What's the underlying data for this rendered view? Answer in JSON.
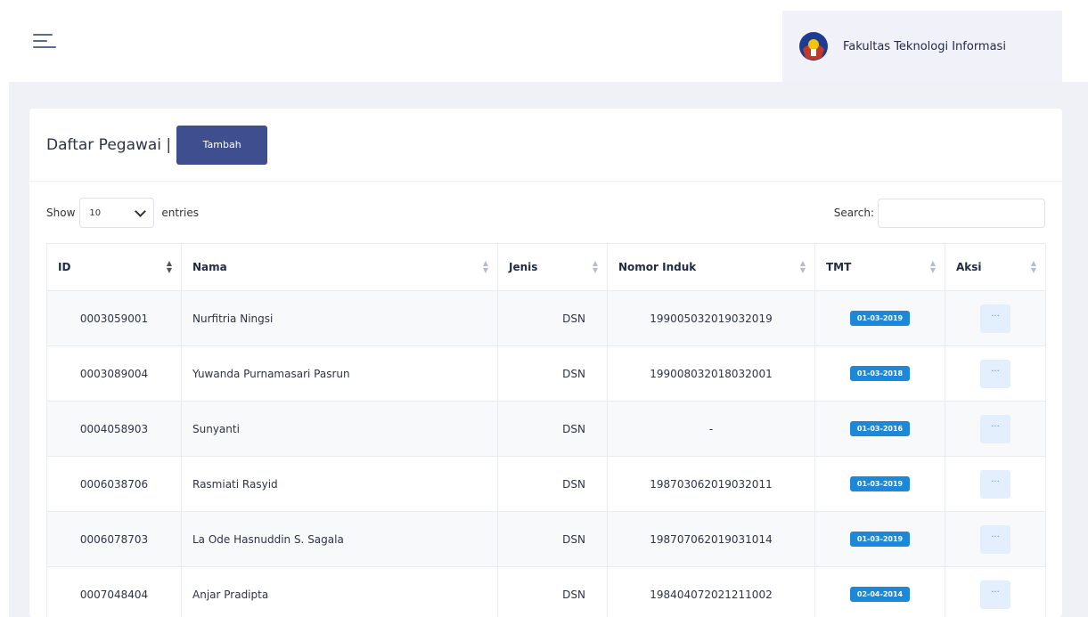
{
  "brand": {
    "name": "Fakultas Teknologi Informasi",
    "logo_icon": "university-logo-icon"
  },
  "card": {
    "title": "Daftar Pegawai |",
    "add_label": "Tambah"
  },
  "controls": {
    "show_label": "Show",
    "entries_value": "10",
    "entries_label": "entries",
    "search_label": "Search:",
    "search_value": ""
  },
  "table": {
    "headers": [
      "ID",
      "Nama",
      "Jenis",
      "Nomor Induk",
      "TMT",
      "Aksi"
    ],
    "rows": [
      {
        "id": "0003059001",
        "nama": "Nurfitria Ningsi",
        "jenis": "DSN",
        "nomor_induk": "199005032019032019",
        "tmt": "01-03-2019",
        "aksi": "···"
      },
      {
        "id": "0003089004",
        "nama": "Yuwanda Purnamasari Pasrun",
        "jenis": "DSN",
        "nomor_induk": "199008032018032001",
        "tmt": "01-03-2018",
        "aksi": "···"
      },
      {
        "id": "0004058903",
        "nama": "Sunyanti",
        "jenis": "DSN",
        "nomor_induk": "-",
        "tmt": "01-03-2016",
        "aksi": "···"
      },
      {
        "id": "0006038706",
        "nama": "Rasmiati Rasyid",
        "jenis": "DSN",
        "nomor_induk": "198703062019032011",
        "tmt": "01-03-2019",
        "aksi": "···"
      },
      {
        "id": "0006078703",
        "nama": "La Ode Hasnuddin S. Sagala",
        "jenis": "DSN",
        "nomor_induk": "198707062019031014",
        "tmt": "01-03-2019",
        "aksi": "···"
      },
      {
        "id": "0007048404",
        "nama": "Anjar Pradipta",
        "jenis": "DSN",
        "nomor_induk": "198404072021211002",
        "tmt": "02-04-2014",
        "aksi": "···"
      }
    ]
  },
  "colors": {
    "primary_button": "#3e4e8f",
    "badge": "#1e88d8",
    "action_button": "#e3effc"
  }
}
